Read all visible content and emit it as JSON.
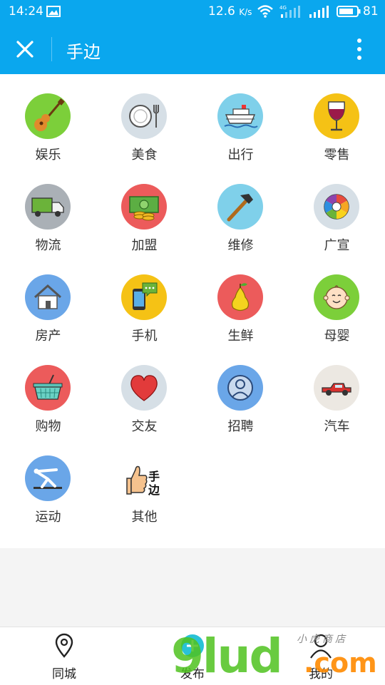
{
  "status_bar": {
    "time": "14:24",
    "speed_value": "12.6",
    "speed_unit": "K/s",
    "network": "4G",
    "battery": "81"
  },
  "app_bar": {
    "title": "手边"
  },
  "categories": [
    {
      "label": "娱乐",
      "icon": "guitar-icon",
      "color": "#7ccf3a"
    },
    {
      "label": "美食",
      "icon": "plate-fork-icon",
      "color": "#d6dfe6"
    },
    {
      "label": "出行",
      "icon": "ship-icon",
      "color": "#7fd0ea"
    },
    {
      "label": "零售",
      "icon": "wine-glass-icon",
      "color": "#f5c215"
    },
    {
      "label": "物流",
      "icon": "truck-icon",
      "color": "#aab0b6"
    },
    {
      "label": "加盟",
      "icon": "money-icon",
      "color": "#ec5b5b"
    },
    {
      "label": "维修",
      "icon": "hammer-icon",
      "color": "#7fd0ea"
    },
    {
      "label": "广宣",
      "icon": "aperture-icon",
      "color": "#d6dfe6"
    },
    {
      "label": "房产",
      "icon": "house-icon",
      "color": "#6aa6e8"
    },
    {
      "label": "手机",
      "icon": "phone-chat-icon",
      "color": "#f5c215"
    },
    {
      "label": "生鲜",
      "icon": "pear-icon",
      "color": "#ec5b5b"
    },
    {
      "label": "母婴",
      "icon": "baby-icon",
      "color": "#7ccf3a"
    },
    {
      "label": "购物",
      "icon": "basket-icon",
      "color": "#ec5b5b"
    },
    {
      "label": "交友",
      "icon": "heart-icon",
      "color": "#d6dfe6"
    },
    {
      "label": "招聘",
      "icon": "person-icon",
      "color": "#6aa6e8"
    },
    {
      "label": "汽车",
      "icon": "car-icon",
      "color": "#ece8e2"
    },
    {
      "label": "运动",
      "icon": "gymnast-icon",
      "color": "#6aa6e8"
    },
    {
      "label": "其他",
      "icon": "thumbs-up-icon",
      "color": "#ffffff",
      "badge_text": "手边"
    }
  ],
  "bottom_nav": {
    "items": [
      {
        "label": "同城",
        "icon": "location-pin-icon"
      },
      {
        "label": "发布",
        "icon": "plus-circle-icon"
      },
      {
        "label": "我的",
        "icon": "user-icon"
      }
    ]
  },
  "watermark": {
    "brand": "9lud",
    "domain": ".com",
    "caption": "小虎商店"
  }
}
